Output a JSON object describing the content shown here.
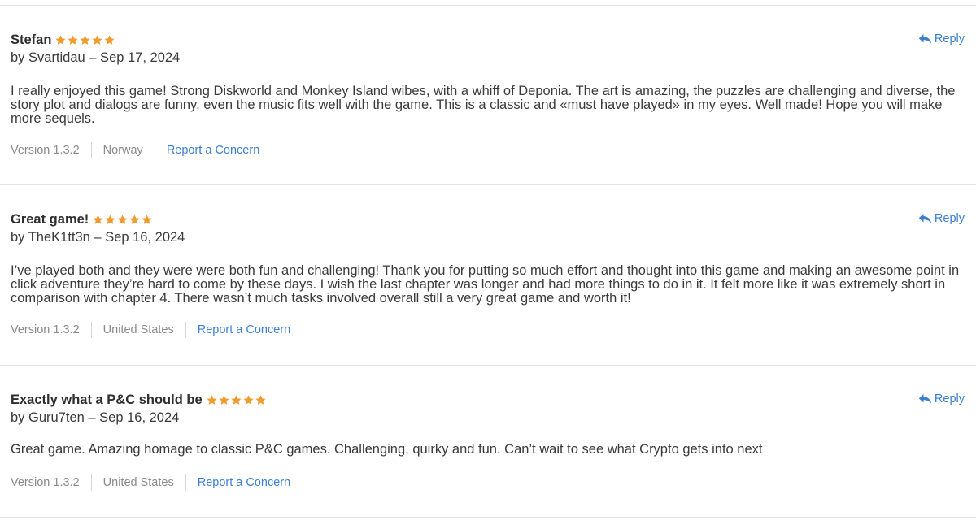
{
  "colors": {
    "star": "#f09b2e",
    "link": "#3a7fd0",
    "meta": "#8a8a8a",
    "divider": "#e1e1e1"
  },
  "reply_label": "Reply",
  "report_label": "Report a Concern",
  "reviews": [
    {
      "title": "Stefan",
      "rating": 5,
      "byline": "by Svartidau – Sep 17, 2024",
      "body": "I really enjoyed this game! Strong Diskworld and Monkey Island wibes, with a whiff of Deponia. The art is amazing, the puzzles are challenging and diverse, the story plot and dialogs are funny, even the music fits well with the game. This is a classic and «must have played» in my eyes. Well made! Hope you will make more sequels.",
      "version": "Version 1.3.2",
      "country": "Norway"
    },
    {
      "title": "Great game!",
      "rating": 5,
      "byline": "by TheK1tt3n – Sep 16, 2024",
      "body": "I’ve played both and they were were both fun and challenging! Thank you for putting so much effort and thought into this game and making an awesome point in click adventure they’re hard to come by these days. I wish the last chapter was longer and had more things to do in it. It felt more like it was extremely short in comparison with chapter 4. There wasn’t much tasks involved overall still a very great game and worth it!",
      "version": "Version 1.3.2",
      "country": "United States"
    },
    {
      "title": "Exactly what a P&C should be",
      "rating": 5,
      "byline": "by Guru7ten – Sep 16, 2024",
      "body": "Great game. Amazing homage to classic P&C games. Challenging, quirky and fun. Can’t wait to see what Crypto gets into next",
      "version": "Version 1.3.2",
      "country": "United States"
    }
  ]
}
